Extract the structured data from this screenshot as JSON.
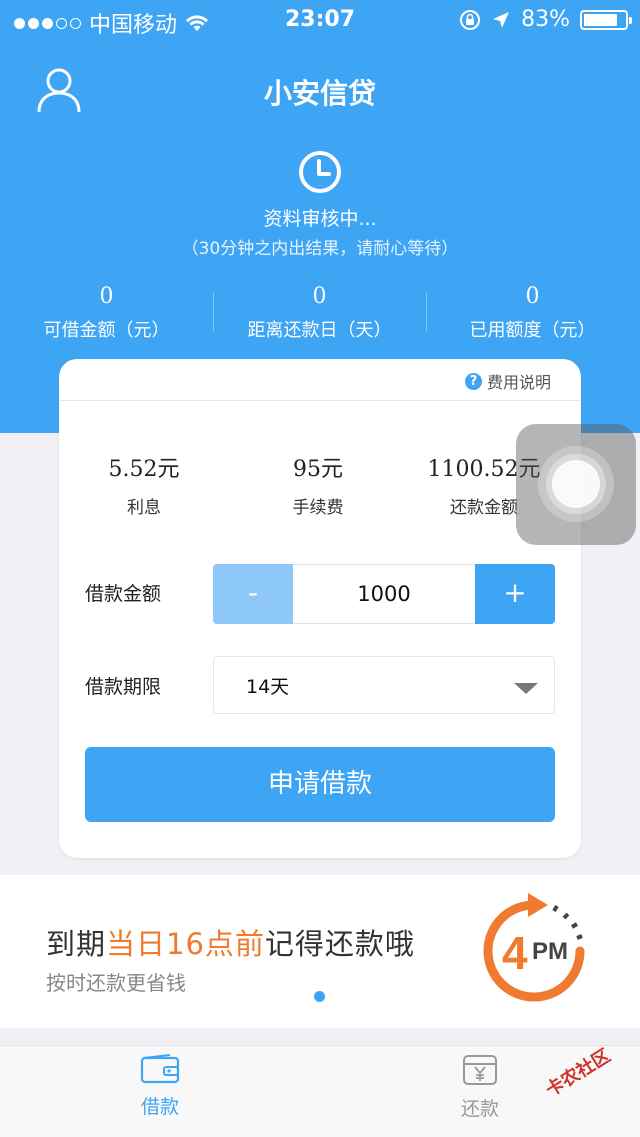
{
  "status_bar": {
    "carrier": "中国移动",
    "time": "23:07",
    "battery": "83%",
    "battery_level": 0.83,
    "signal_dots_filled": 3,
    "signal_dots_total": 5
  },
  "header": {
    "title": "小安信贷"
  },
  "review": {
    "title": "资料审核中...",
    "subtitle": "（30分钟之内出结果，请耐心等待）"
  },
  "stats": [
    {
      "value": "0",
      "label": "可借金额（元）"
    },
    {
      "value": "0",
      "label": "距离还款日（天）"
    },
    {
      "value": "0",
      "label": "已用额度（元）"
    }
  ],
  "card": {
    "fee_link": "费用说明",
    "summary": [
      {
        "value": "5.52元",
        "label": "利息"
      },
      {
        "value": "95元",
        "label": "手续费"
      },
      {
        "value": "1100.52元",
        "label": "还款金额"
      }
    ],
    "amount_label": "借款金额",
    "amount_value": "1000",
    "minus_label": "-",
    "plus_label": "+",
    "term_label": "借款期限",
    "term_value": "14天",
    "apply_label": "申请借款"
  },
  "banner": {
    "title_pre": "到期",
    "title_highlight": "当日16点前",
    "title_post": "记得还款哦",
    "subtitle": "按时还款更省钱",
    "pm_number": "4",
    "pm_text": "PM"
  },
  "tabs": [
    {
      "label": "借款",
      "active": true
    },
    {
      "label": "还款",
      "active": false
    }
  ],
  "watermark": "卡农社区",
  "colors": {
    "brand": "#3ea5f5",
    "accent": "#f07a2f"
  }
}
